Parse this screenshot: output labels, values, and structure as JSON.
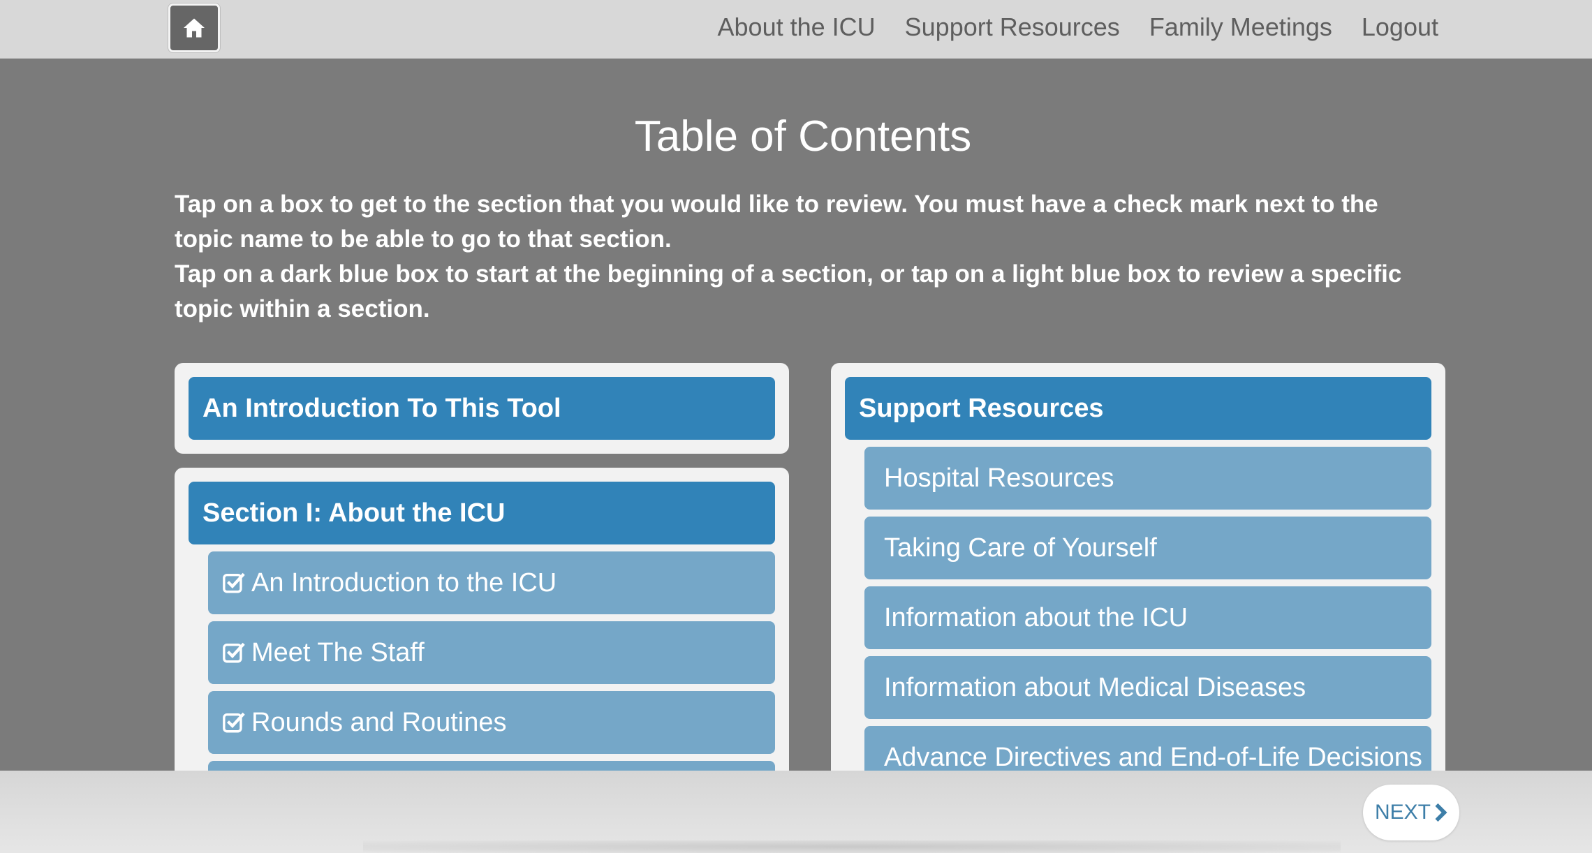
{
  "nav": {
    "home_icon": "home-icon",
    "items": [
      "About the ICU",
      "Support Resources",
      "Family Meetings",
      "Logout"
    ]
  },
  "main": {
    "title": "Table of Contents",
    "instructions": [
      "Tap on a box to get to the section that you would like to review. You must have a check mark next to the topic name to be able to go to that section.",
      "Tap on a dark blue box to start at the beginning of a section, or tap on a light blue box to review a specific topic within a section."
    ]
  },
  "intro_panel": {
    "label": "An Introduction To This Tool"
  },
  "section1": {
    "label": "Section I: About the ICU",
    "items": [
      "An Introduction to the ICU",
      "Meet The Staff",
      "Rounds and Routines",
      ""
    ]
  },
  "support": {
    "label": "Support Resources",
    "items": [
      "Hospital Resources",
      "Taking Care of Yourself",
      "Information about the ICU",
      "Information about Medical Diseases",
      "Advance Directives and End-of-Life Decisions"
    ]
  },
  "footer": {
    "next_label": "NEXT"
  },
  "colors": {
    "dark_blue": "#3183b8",
    "light_blue": "#75a7c8",
    "background": "#7b7b7b",
    "nav_bar": "#d8d8d8"
  }
}
